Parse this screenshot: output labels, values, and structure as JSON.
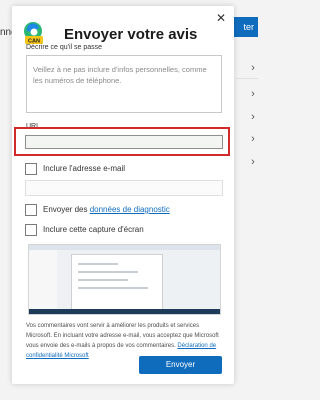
{
  "background": {
    "left_text": "nne",
    "right_button_label": "ter"
  },
  "panel": {
    "title": "Envoyer votre avis",
    "describe_label": "Décrire ce qu'il se passe",
    "describe_placeholder": "Veillez à ne pas inclure d'infos personnelles, comme les numéros de téléphone.",
    "url_label": "URL",
    "url_value": "",
    "include_email_label": "Inclure l'adresse e-mail",
    "email_value": "",
    "diagnostic_prefix": "Envoyer des ",
    "diagnostic_link": "données de diagnostic",
    "screenshot_label": "Inclure cette capture d'écran",
    "footer_text": "Vos commentaires vont servir à améliorer les produits et services Microsoft. En incluant votre adresse e-mail, vous acceptez que Microsoft vous envoie des e-mails à propos de vos commentaires.",
    "privacy_link": "Déclaration de confidentialité Microsoft",
    "send_label": "Envoyer"
  },
  "icons": {
    "logo": "edge-canary-logo-icon",
    "close": "close-icon",
    "background_chevrons": "chevron-right-icon"
  },
  "colors": {
    "accent": "#0f6cbd",
    "highlight": "#d12a2a"
  }
}
